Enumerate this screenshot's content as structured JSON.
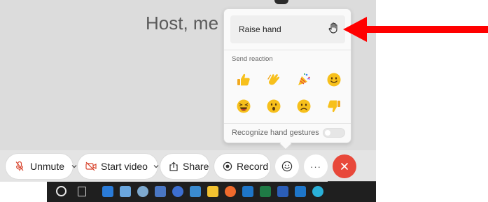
{
  "meeting": {
    "title": "Host, me"
  },
  "popup": {
    "raise_hand_label": "Raise hand",
    "send_reaction_label": "Send reaction",
    "reactions": [
      {
        "name": "thumbs-up",
        "glyph": "👍"
      },
      {
        "name": "clap",
        "glyph": "👏"
      },
      {
        "name": "celebrate",
        "glyph": "🎉"
      },
      {
        "name": "smile",
        "glyph": "🙂"
      },
      {
        "name": "laugh",
        "glyph": "😆"
      },
      {
        "name": "surprised",
        "glyph": "😮"
      },
      {
        "name": "sad",
        "glyph": "☹"
      },
      {
        "name": "thumbs-down",
        "glyph": "👎"
      }
    ],
    "gestures_label": "Recognize hand gestures",
    "gestures_enabled": false
  },
  "toolbar": {
    "unmute_label": "Unmute",
    "start_video_label": "Start video",
    "share_label": "Share",
    "record_label": "Record",
    "more_label": "···"
  },
  "colors": {
    "leave_button": "#e8483a",
    "annotation_arrow": "#ff0000",
    "mic_muted": "#d8452e",
    "video_off": "#d8452e",
    "reaction_yellow": "#f7c01c"
  },
  "taskbar": {
    "icons": [
      "start-icon",
      "task-view-icon",
      "mail-icon",
      "photos-icon",
      "search-icon",
      "sas-icon",
      "app-icon",
      "calculator-icon",
      "file-explorer-icon",
      "firefox-icon",
      "outlook-icon",
      "excel-icon",
      "word-icon",
      "outlook-icon-2",
      "browser-icon"
    ]
  }
}
